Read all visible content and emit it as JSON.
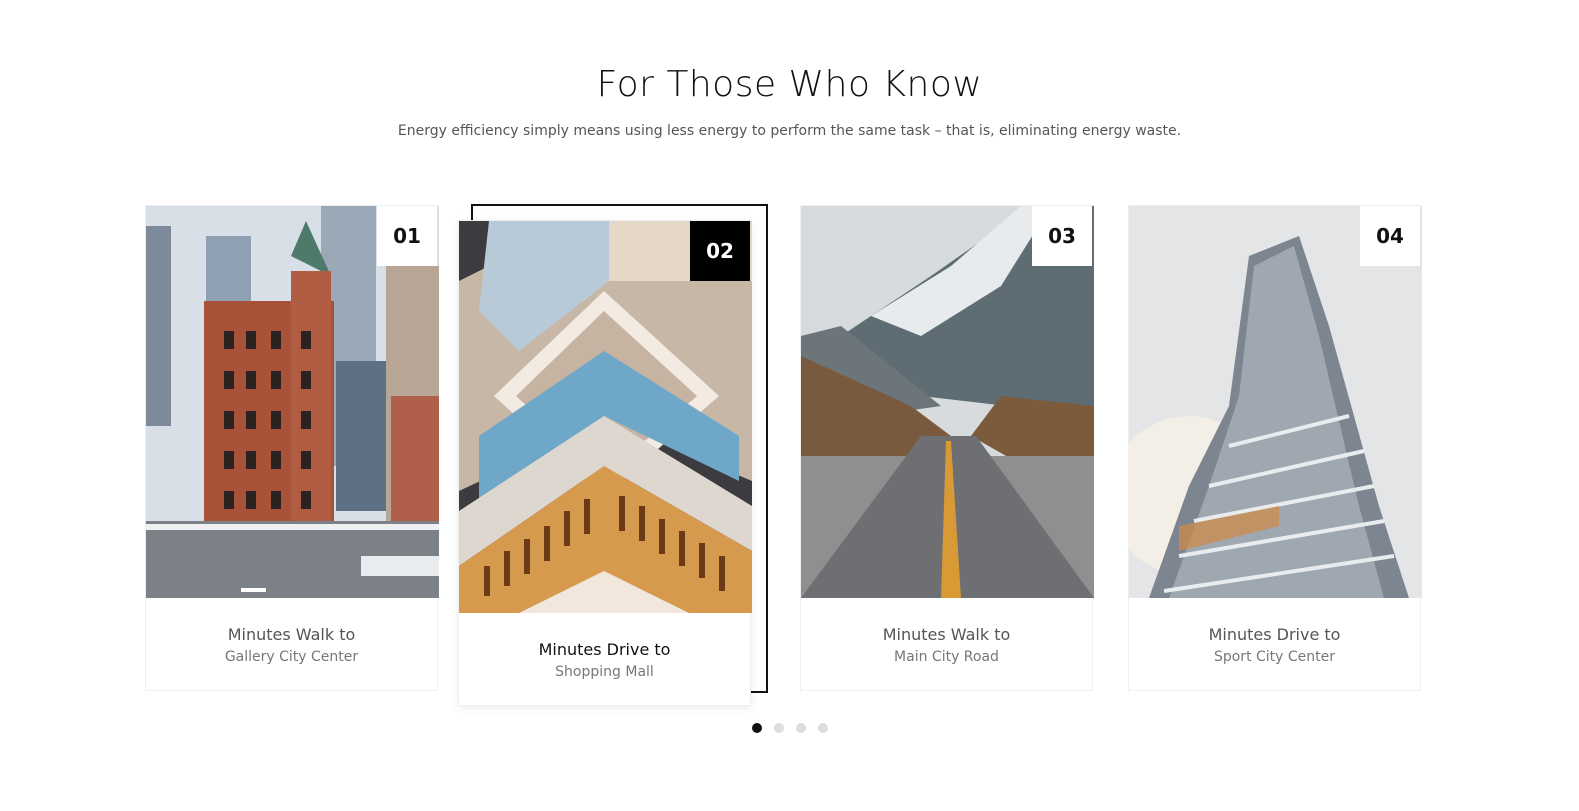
{
  "section": {
    "title": "For Those Who Know",
    "subtitle": "Energy efficiency simply means using less energy to perform the same task – that is, eliminating energy waste."
  },
  "cards": [
    {
      "number": "01",
      "line1": "Minutes Walk to",
      "line2": "Gallery City Center",
      "image": "city-street-photo"
    },
    {
      "number": "02",
      "line1": "Minutes Drive to",
      "line2": "Shopping Mall",
      "image": "modern-building-interior-photo"
    },
    {
      "number": "03",
      "line1": "Minutes Walk to",
      "line2": "Main City Road",
      "image": "mountain-road-photo"
    },
    {
      "number": "04",
      "line1": "Minutes Drive to",
      "line2": "Sport City Center",
      "image": "twisted-skyscraper-photo"
    }
  ],
  "carousel": {
    "active_index": 1,
    "total_pages": 4
  },
  "colors": {
    "accent": "#000000",
    "muted_text": "#777777",
    "dot_inactive": "#dddddd"
  }
}
